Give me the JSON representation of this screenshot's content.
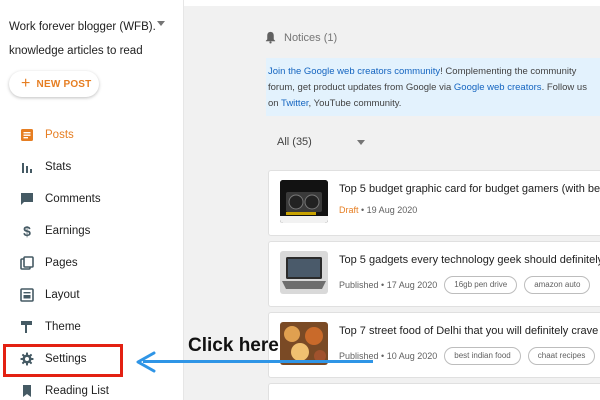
{
  "sidebar": {
    "blog_title": "Work forever blogger (WFB). knowledge articles to read",
    "new_post_label": "NEW POST",
    "items": [
      {
        "label": "Posts",
        "icon": "posts-icon"
      },
      {
        "label": "Stats",
        "icon": "stats-icon"
      },
      {
        "label": "Comments",
        "icon": "comments-icon"
      },
      {
        "label": "Earnings",
        "icon": "dollar-icon"
      },
      {
        "label": "Pages",
        "icon": "pages-icon"
      },
      {
        "label": "Layout",
        "icon": "layout-icon"
      },
      {
        "label": "Theme",
        "icon": "theme-icon"
      },
      {
        "label": "Settings",
        "icon": "gear-icon"
      },
      {
        "label": "Reading List",
        "icon": "bookmark-icon"
      }
    ]
  },
  "main": {
    "notices_label": "Notices (1)",
    "banner": {
      "link1": "Join the Google web creators community",
      "text1": "! Complementing the community forum, get product updates from Google via ",
      "link2": "Google web creators",
      "text2": ". Follow us on ",
      "link3": "Twitter",
      "text3": ", YouTube community."
    },
    "filter_label": "All (35)",
    "posts": [
      {
        "title": "Top 5 budget graphic card for budget gamers (with be",
        "status": "Draft",
        "date": "19 Aug 2020",
        "labels": []
      },
      {
        "title": "Top 5 gadgets every technology geek should definitely",
        "status": "Published",
        "date": "17 Aug 2020",
        "labels": [
          "16gb pen drive",
          "amazon auto"
        ]
      },
      {
        "title": "Top 7 street food of Delhi that you will definitely crave",
        "status": "Published",
        "date": "10 Aug 2020",
        "labels": [
          "best indian food",
          "chaat recipes"
        ]
      }
    ]
  },
  "annotation": {
    "text": "Click here",
    "highlight_color": "#e32012",
    "arrow_color": "#2f95e6"
  },
  "colors": {
    "accent": "#e67e22",
    "link": "#1565c0",
    "banner_bg": "#e3f2fd"
  }
}
